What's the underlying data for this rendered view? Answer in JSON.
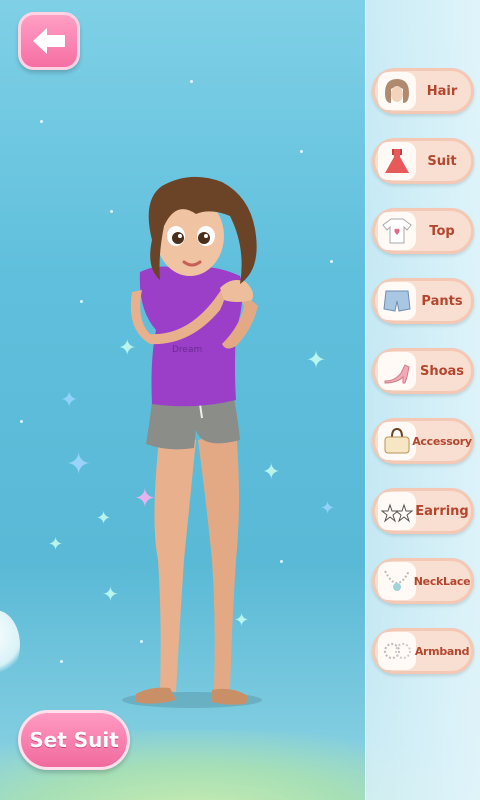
{
  "categories": [
    {
      "label": "Hair",
      "icon": "hair-icon"
    },
    {
      "label": "Suit",
      "icon": "dress-icon"
    },
    {
      "label": "Top",
      "icon": "tshirt-icon"
    },
    {
      "label": "Pants",
      "icon": "shorts-icon"
    },
    {
      "label": "Shoas",
      "icon": "high-heels-icon"
    },
    {
      "label": "Accessory",
      "icon": "handbag-icon"
    },
    {
      "label": "Earring",
      "icon": "star-earrings-icon"
    },
    {
      "label": "NeckLace",
      "icon": "necklace-icon"
    },
    {
      "label": "Armband",
      "icon": "bracelet-icon"
    }
  ],
  "actions": {
    "set_suit_label": "Set Suit"
  },
  "colors": {
    "accent": "#f56fa3",
    "panel_button": "#f9dfd2",
    "label": "#b3472e",
    "shirt": "#9b3fc8",
    "shorts": "#8a8d88",
    "hair": "#6b4326"
  }
}
